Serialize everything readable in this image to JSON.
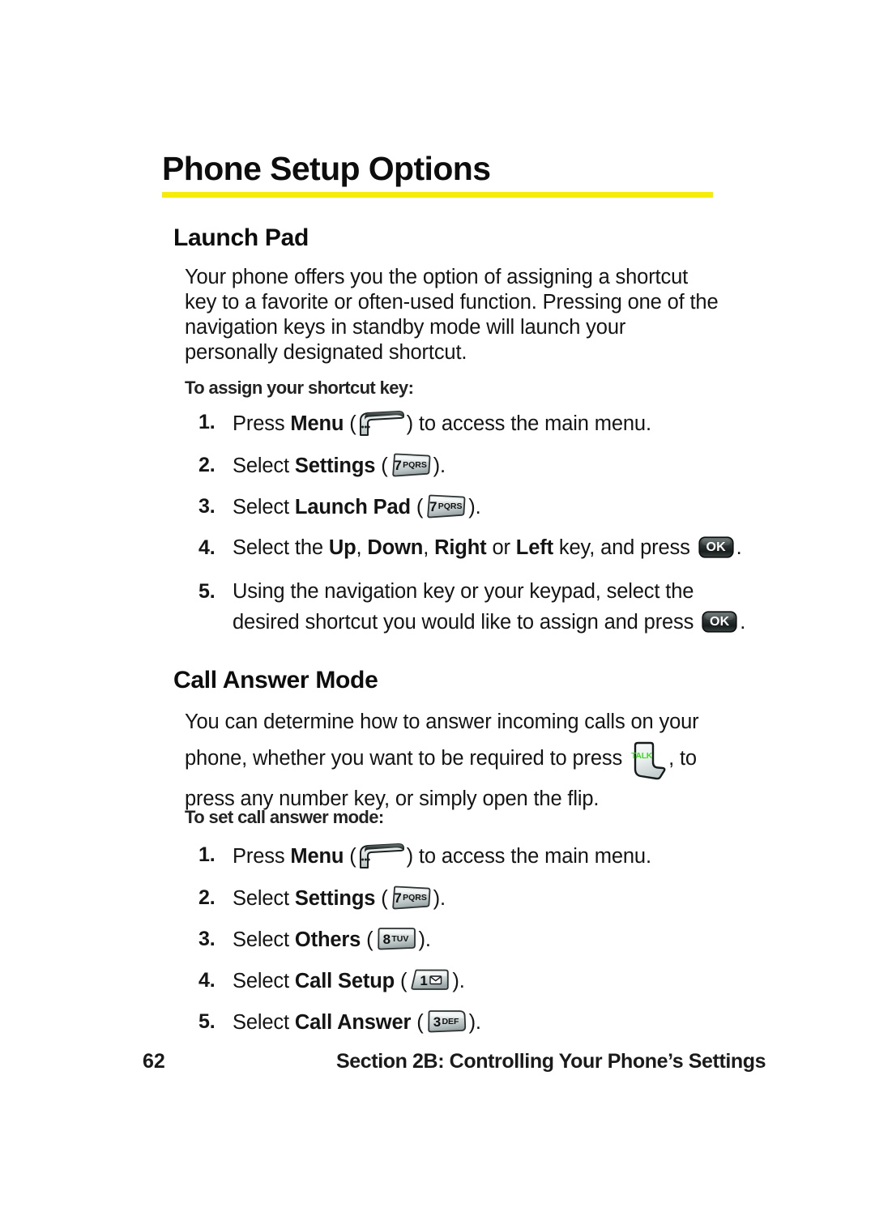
{
  "document": {
    "title": "Phone Setup Options",
    "rule_color": "#f5ec0a"
  },
  "sections": [
    {
      "heading": "Launch Pad",
      "paragraph": "Your phone offers you the option of assigning a shortcut key to a favorite or often-used function. Pressing one of the navigation keys in standby mode will launch your personally designated shortcut.",
      "subheading": "To assign your shortcut key:",
      "steps": [
        {
          "number": "1.",
          "lead": "Press ",
          "bold": "Menu",
          "mid": " (",
          "key": "menu-soft-key",
          "tail": ") to access the main menu."
        },
        {
          "number": "2.",
          "lead": "Select ",
          "bold": "Settings",
          "mid": " (",
          "key": "7pqrs-key",
          "tail": ")."
        },
        {
          "number": "3.",
          "lead": "Select ",
          "bold": "Launch Pad",
          "mid": " (",
          "key": "7pqrs-key",
          "tail": ")."
        },
        {
          "number": "4.",
          "lead": "Select the ",
          "bold": "Up, Down, Right or Left",
          "mid": " key, and press ",
          "key": "ok-key",
          "tail": "."
        },
        {
          "number": "5.",
          "lead": "Using the navigation key or your keypad, select the desired shortcut you would like to assign and press ",
          "bold": "",
          "mid": "",
          "key": "ok-key",
          "tail": "."
        }
      ]
    },
    {
      "heading": "Call Answer Mode",
      "paragraph_part1": "You can determine how to answer incoming calls on your phone, whether you want to be required to press ",
      "paragraph_key": "talk-key",
      "paragraph_part2": ", to press any number key, or simply open the flip.",
      "subheading": "To set call answer mode:",
      "steps": [
        {
          "number": "1.",
          "lead": "Press ",
          "bold": "Menu",
          "mid": " (",
          "key": "menu-soft-key",
          "tail": ") to access the main menu."
        },
        {
          "number": "2.",
          "lead": "Select ",
          "bold": "Settings",
          "mid": " (",
          "key": "7pqrs-key",
          "tail": ")."
        },
        {
          "number": "3.",
          "lead": "Select ",
          "bold": "Others",
          "mid": " (",
          "key": "8tuv-key",
          "tail": ")."
        },
        {
          "number": "4.",
          "lead": "Select ",
          "bold": "Call Setup",
          "mid": " (",
          "key": "1-envelope-key",
          "tail": ")."
        },
        {
          "number": "5.",
          "lead": "Select ",
          "bold": "Call Answer",
          "mid": " (",
          "key": "3def-key",
          "tail": ")."
        }
      ]
    }
  ],
  "step_text": {
    "s1_lead": "Press ",
    "s1_bold": "Menu",
    "s1_open": " (",
    "s1_tail": ") to access the main menu.",
    "s2_lead": "Select ",
    "s2_bold": "Settings",
    "s2_open": " (",
    "s2_tail": ").",
    "s3a_lead": "Select ",
    "s3a_bold": "Launch Pad",
    "s3a_open": " (",
    "s3a_tail": ").",
    "s4a_lead": "Select the ",
    "s4a_b1": "Up",
    "s4a_c1": ", ",
    "s4a_b2": "Down",
    "s4a_c2": ", ",
    "s4a_b3": "Right",
    "s4a_or": " or ",
    "s4a_b4": "Left",
    "s4a_mid": " key, and press ",
    "s4a_tail": ".",
    "s5a_lead": "Using the navigation key or your keypad, select the desired shortcut you would like to assign and ",
    "s5a_press": "press ",
    "s5a_tail": ".",
    "s3b_lead": "Select ",
    "s3b_bold": "Others",
    "s3b_open": " (",
    "s3b_tail": ").",
    "s4b_lead": "Select ",
    "s4b_bold": "Call Setup",
    "s4b_open": " (",
    "s4b_tail": ").",
    "s5b_lead": "Select ",
    "s5b_bold": "Call Answer",
    "s5b_open": " (",
    "s5b_tail": ")."
  },
  "keys": {
    "seven": {
      "digit": "7",
      "letters": "PQRS"
    },
    "eight": {
      "digit": "8",
      "letters": "TUV"
    },
    "three": {
      "digit": "3",
      "letters": "DEF"
    },
    "one": {
      "digit": "1",
      "letters": ""
    },
    "ok": {
      "label": "OK"
    },
    "talk": {
      "label": "TALK",
      "color": "#3fdb1f"
    }
  },
  "footer": {
    "page_number": "62",
    "section_label": "Section 2B: Controlling Your Phone’s Settings"
  }
}
